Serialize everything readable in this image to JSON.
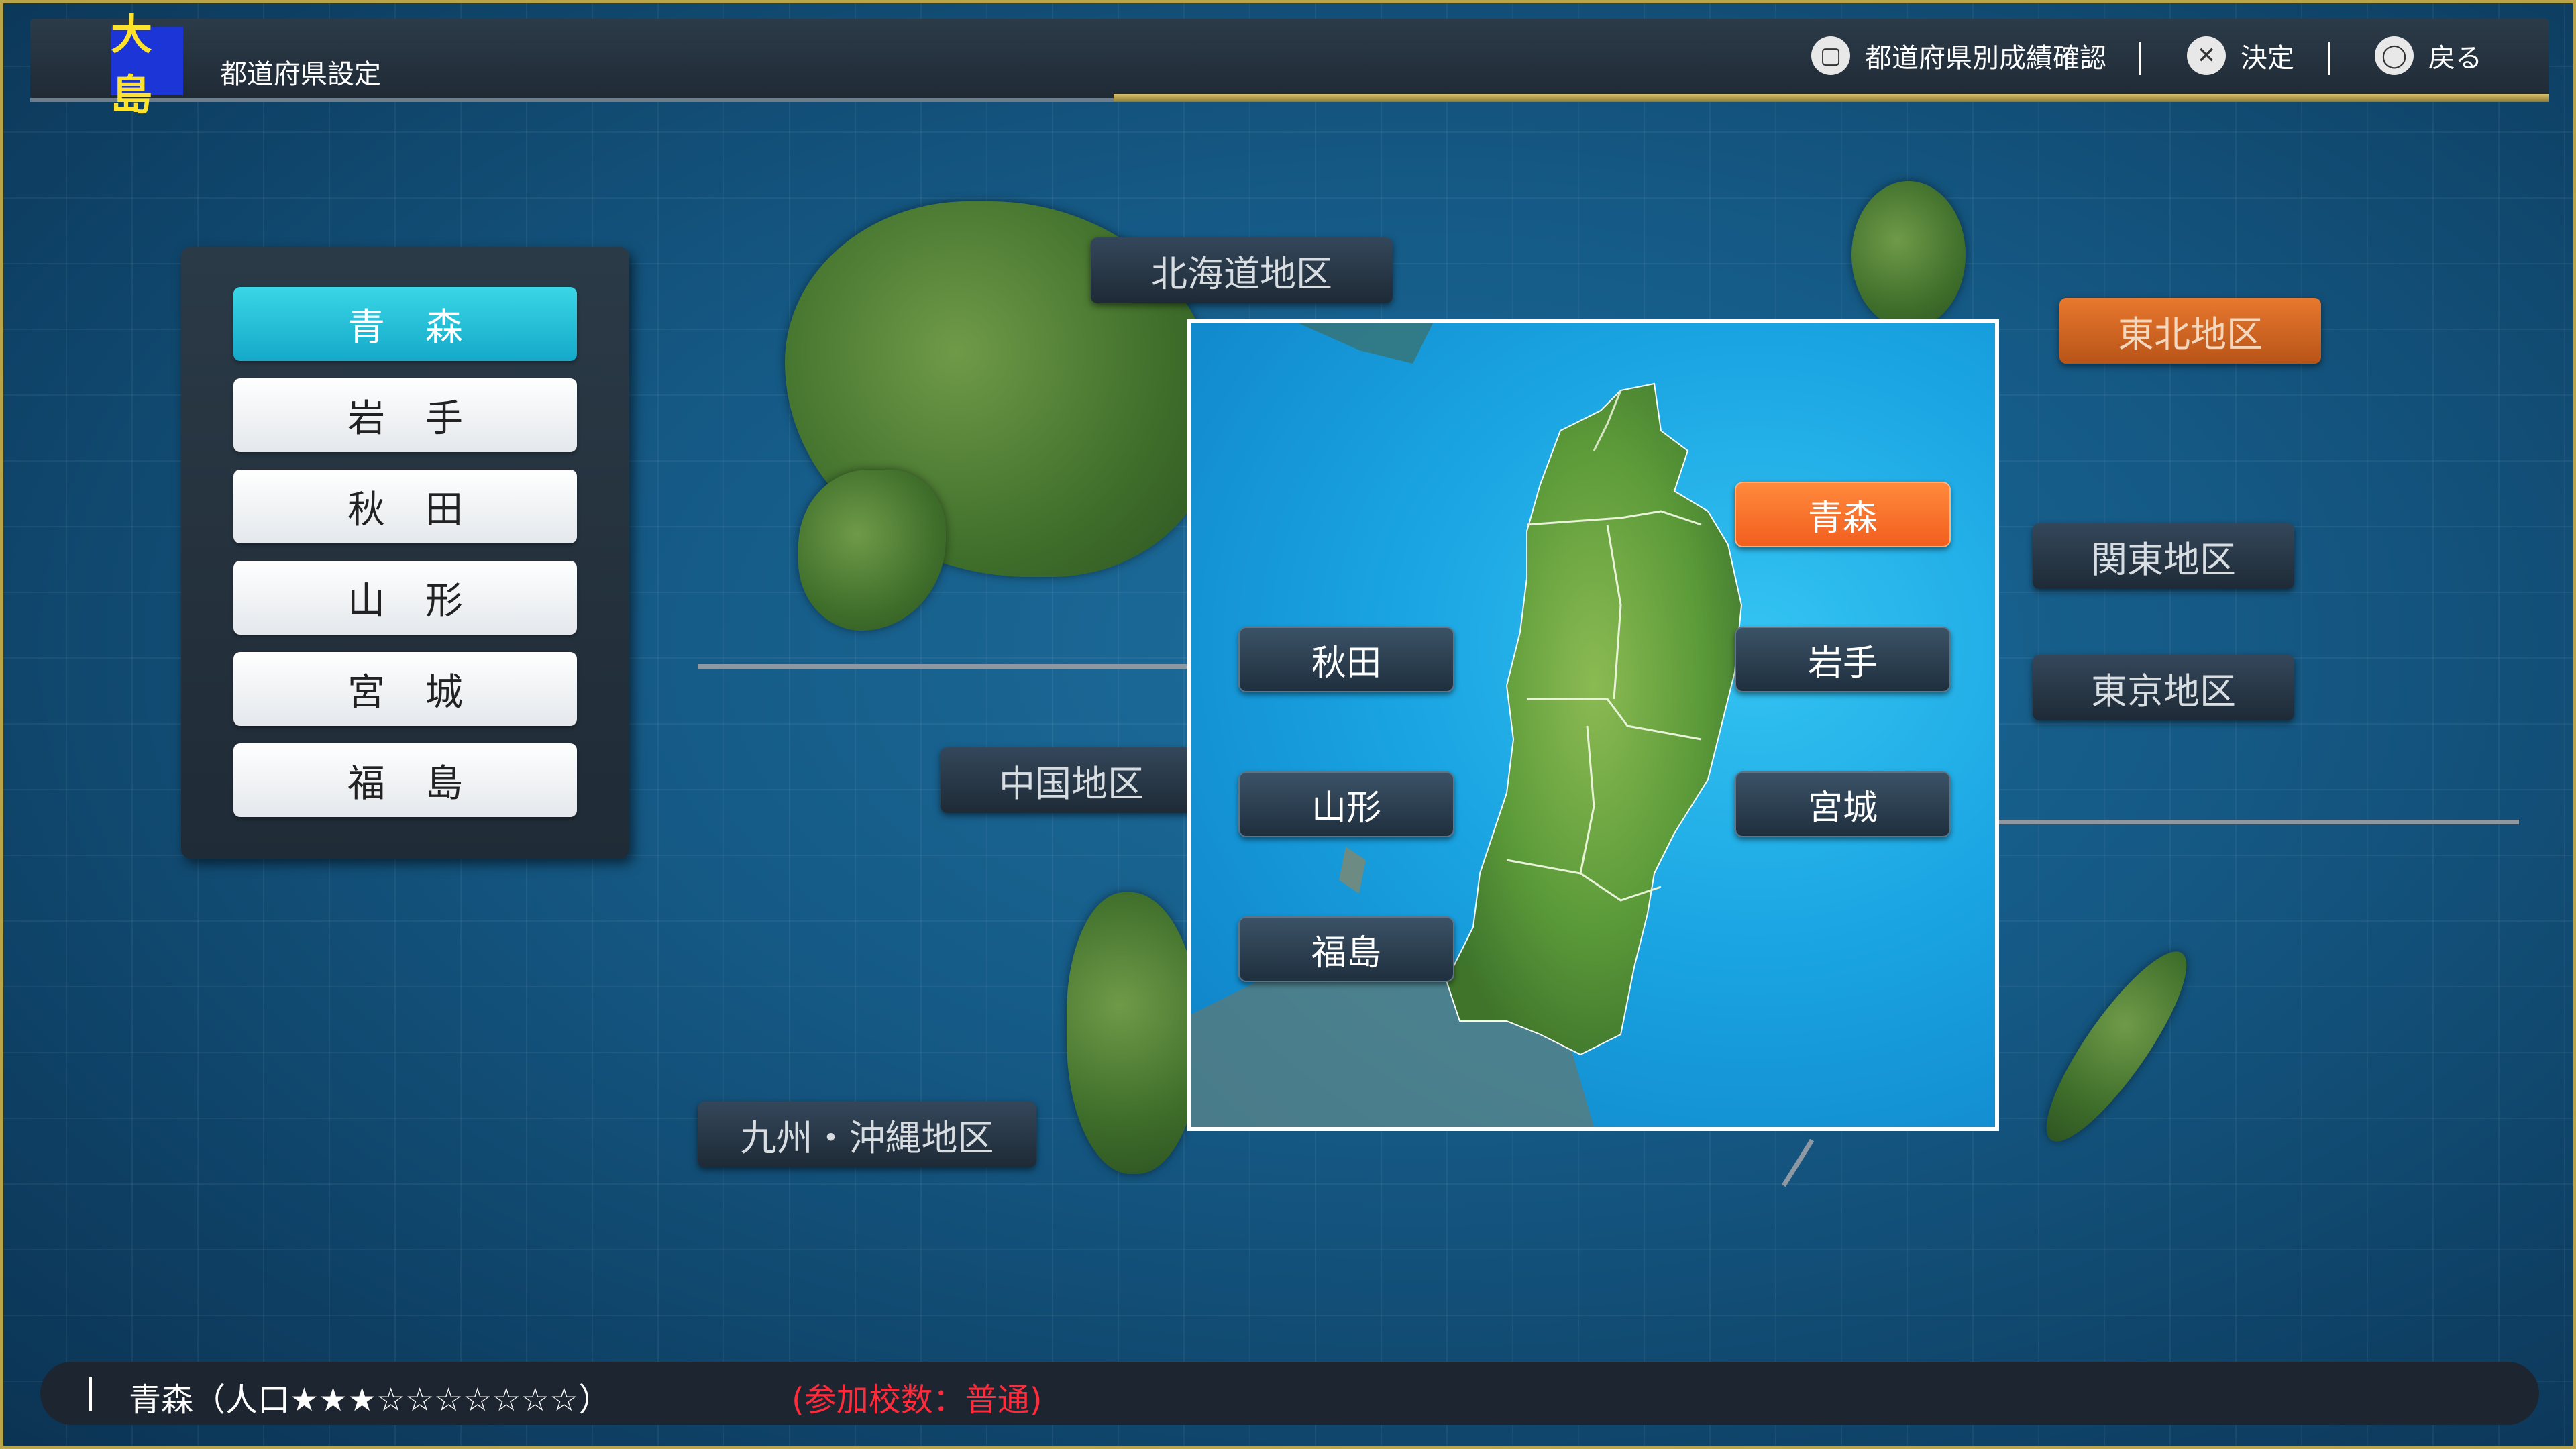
{
  "header": {
    "logo_text": "大島",
    "title": "都道府県設定",
    "controls": [
      {
        "icon": "square-button-icon",
        "label": "都道府県別成績確認"
      },
      {
        "icon": "cross-button-icon",
        "label": "決定"
      },
      {
        "icon": "circle-button-icon",
        "label": "戻る"
      }
    ]
  },
  "prefecture_list": [
    {
      "label": "青森",
      "selected": true
    },
    {
      "label": "岩手",
      "selected": false
    },
    {
      "label": "秋田",
      "selected": false
    },
    {
      "label": "山形",
      "selected": false
    },
    {
      "label": "宮城",
      "selected": false
    },
    {
      "label": "福島",
      "selected": false
    }
  ],
  "regions": {
    "hokkaido": "北海道地区",
    "tohoku": "東北地区",
    "kanto": "関東地区",
    "tokyo": "東京地区",
    "chugoku": "中国地区",
    "kyushu": "九州・沖縄地区"
  },
  "active_region": "東北地区",
  "zoom_map": {
    "aomori": "青森",
    "akita": "秋田",
    "iwate": "岩手",
    "yamagata": "山形",
    "miyagi": "宮城",
    "fukushima": "福島",
    "highlighted": "青森"
  },
  "footer": {
    "info": "青森（人口★★★☆☆☆☆☆☆☆）",
    "note": "(参加校数：普通)"
  },
  "colors": {
    "selected_list": "#14a9c9",
    "active_region": "#e8782e",
    "highlight_pref": "#f25e1e",
    "footer_note": "#ff2a3a"
  }
}
